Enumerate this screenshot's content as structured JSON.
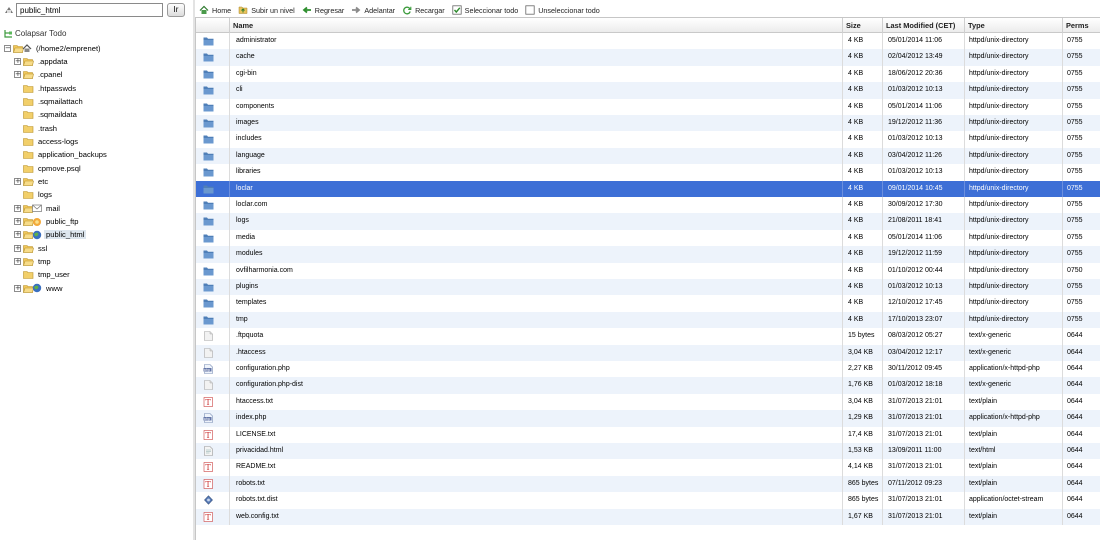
{
  "path_bar": {
    "value": "public_html",
    "go_label": "Ir"
  },
  "collapse_label": "Colapsar Todo",
  "tree": [
    {
      "label": "(/home2/emprenet)",
      "depth": 0,
      "toggle": "−",
      "kind": "root"
    },
    {
      "label": ".appdata",
      "depth": 1,
      "toggle": "+",
      "kind": "folder"
    },
    {
      "label": ".cpanel",
      "depth": 1,
      "toggle": "+",
      "kind": "folder"
    },
    {
      "label": ".htpasswds",
      "depth": 1,
      "toggle": "",
      "kind": "folder"
    },
    {
      "label": ".sqmailattach",
      "depth": 1,
      "toggle": "",
      "kind": "folder"
    },
    {
      "label": ".sqmaildata",
      "depth": 1,
      "toggle": "",
      "kind": "folder"
    },
    {
      "label": ".trash",
      "depth": 1,
      "toggle": "",
      "kind": "folder"
    },
    {
      "label": "access-logs",
      "depth": 1,
      "toggle": "",
      "kind": "folder"
    },
    {
      "label": "application_backups",
      "depth": 1,
      "toggle": "",
      "kind": "folder"
    },
    {
      "label": "cpmove.psql",
      "depth": 1,
      "toggle": "",
      "kind": "folder"
    },
    {
      "label": "etc",
      "depth": 1,
      "toggle": "+",
      "kind": "folder"
    },
    {
      "label": "logs",
      "depth": 1,
      "toggle": "",
      "kind": "folder"
    },
    {
      "label": "mail",
      "depth": 1,
      "toggle": "+",
      "kind": "mail"
    },
    {
      "label": "public_ftp",
      "depth": 1,
      "toggle": "+",
      "kind": "ftp"
    },
    {
      "label": "public_html",
      "depth": 1,
      "toggle": "+",
      "kind": "web",
      "selected": true
    },
    {
      "label": "ssl",
      "depth": 1,
      "toggle": "+",
      "kind": "folder"
    },
    {
      "label": "tmp",
      "depth": 1,
      "toggle": "+",
      "kind": "folder"
    },
    {
      "label": "tmp_user",
      "depth": 1,
      "toggle": "",
      "kind": "folder"
    },
    {
      "label": "www",
      "depth": 1,
      "toggle": "+",
      "kind": "web"
    }
  ],
  "toolbar": [
    {
      "label": "Home",
      "icon": "home-icon"
    },
    {
      "label": "Subir un nivel",
      "icon": "up-level-icon"
    },
    {
      "label": "Regresar",
      "icon": "back-arrow-icon"
    },
    {
      "label": "Adelantar",
      "icon": "forward-arrow-icon"
    },
    {
      "label": "Recargar",
      "icon": "reload-icon"
    },
    {
      "label": "Seleccionar todo",
      "icon": "select-all-icon"
    },
    {
      "label": "Unseleccionar todo",
      "icon": "unselect-all-icon"
    }
  ],
  "columns": {
    "name": "Name",
    "size": "Size",
    "modified": "Last Modified (CET)",
    "type": "Type",
    "perms": "Perms"
  },
  "files": [
    {
      "name": "administrator",
      "size": "4 KB",
      "modified": "05/01/2014 11:06",
      "type": "httpd/unix-directory",
      "perms": "0755",
      "icon": "folder"
    },
    {
      "name": "cache",
      "size": "4 KB",
      "modified": "02/04/2012 13:49",
      "type": "httpd/unix-directory",
      "perms": "0755",
      "icon": "folder"
    },
    {
      "name": "cgi-bin",
      "size": "4 KB",
      "modified": "18/06/2012 20:36",
      "type": "httpd/unix-directory",
      "perms": "0755",
      "icon": "folder"
    },
    {
      "name": "cli",
      "size": "4 KB",
      "modified": "01/03/2012 10:13",
      "type": "httpd/unix-directory",
      "perms": "0755",
      "icon": "folder"
    },
    {
      "name": "components",
      "size": "4 KB",
      "modified": "05/01/2014 11:06",
      "type": "httpd/unix-directory",
      "perms": "0755",
      "icon": "folder"
    },
    {
      "name": "images",
      "size": "4 KB",
      "modified": "19/12/2012 11:36",
      "type": "httpd/unix-directory",
      "perms": "0755",
      "icon": "folder"
    },
    {
      "name": "includes",
      "size": "4 KB",
      "modified": "01/03/2012 10:13",
      "type": "httpd/unix-directory",
      "perms": "0755",
      "icon": "folder"
    },
    {
      "name": "language",
      "size": "4 KB",
      "modified": "03/04/2012 11:26",
      "type": "httpd/unix-directory",
      "perms": "0755",
      "icon": "folder"
    },
    {
      "name": "libraries",
      "size": "4 KB",
      "modified": "01/03/2012 10:13",
      "type": "httpd/unix-directory",
      "perms": "0755",
      "icon": "folder"
    },
    {
      "name": "loclar",
      "size": "4 KB",
      "modified": "09/01/2014 10:45",
      "type": "httpd/unix-directory",
      "perms": "0755",
      "icon": "folder",
      "selected": true
    },
    {
      "name": "loclar.com",
      "size": "4 KB",
      "modified": "30/09/2012 17:30",
      "type": "httpd/unix-directory",
      "perms": "0755",
      "icon": "folder"
    },
    {
      "name": "logs",
      "size": "4 KB",
      "modified": "21/08/2011 18:41",
      "type": "httpd/unix-directory",
      "perms": "0755",
      "icon": "folder"
    },
    {
      "name": "media",
      "size": "4 KB",
      "modified": "05/01/2014 11:06",
      "type": "httpd/unix-directory",
      "perms": "0755",
      "icon": "folder"
    },
    {
      "name": "modules",
      "size": "4 KB",
      "modified": "19/12/2012 11:59",
      "type": "httpd/unix-directory",
      "perms": "0755",
      "icon": "folder"
    },
    {
      "name": "ovfilharmonia.com",
      "size": "4 KB",
      "modified": "01/10/2012 00:44",
      "type": "httpd/unix-directory",
      "perms": "0750",
      "icon": "folder"
    },
    {
      "name": "plugins",
      "size": "4 KB",
      "modified": "01/03/2012 10:13",
      "type": "httpd/unix-directory",
      "perms": "0755",
      "icon": "folder"
    },
    {
      "name": "templates",
      "size": "4 KB",
      "modified": "12/10/2012 17:45",
      "type": "httpd/unix-directory",
      "perms": "0755",
      "icon": "folder"
    },
    {
      "name": "tmp",
      "size": "4 KB",
      "modified": "17/10/2013 23:07",
      "type": "httpd/unix-directory",
      "perms": "0755",
      "icon": "folder"
    },
    {
      "name": ".ftpquota",
      "size": "15 bytes",
      "modified": "08/03/2012 05:27",
      "type": "text/x-generic",
      "perms": "0644",
      "icon": "generic"
    },
    {
      "name": ".htaccess",
      "size": "3,04 KB",
      "modified": "03/04/2012 12:17",
      "type": "text/x-generic",
      "perms": "0644",
      "icon": "generic"
    },
    {
      "name": "configuration.php",
      "size": "2,27 KB",
      "modified": "30/11/2012 09:45",
      "type": "application/x-httpd-php",
      "perms": "0644",
      "icon": "php"
    },
    {
      "name": "configuration.php-dist",
      "size": "1,76 KB",
      "modified": "01/03/2012 18:18",
      "type": "text/x-generic",
      "perms": "0644",
      "icon": "generic"
    },
    {
      "name": "htaccess.txt",
      "size": "3,04 KB",
      "modified": "31/07/2013 21:01",
      "type": "text/plain",
      "perms": "0644",
      "icon": "text"
    },
    {
      "name": "index.php",
      "size": "1,29 KB",
      "modified": "31/07/2013 21:01",
      "type": "application/x-httpd-php",
      "perms": "0644",
      "icon": "php"
    },
    {
      "name": "LICENSE.txt",
      "size": "17,4 KB",
      "modified": "31/07/2013 21:01",
      "type": "text/plain",
      "perms": "0644",
      "icon": "text"
    },
    {
      "name": "privacidad.html",
      "size": "1,53 KB",
      "modified": "13/09/2011 11:00",
      "type": "text/html",
      "perms": "0644",
      "icon": "html"
    },
    {
      "name": "README.txt",
      "size": "4,14 KB",
      "modified": "31/07/2013 21:01",
      "type": "text/plain",
      "perms": "0644",
      "icon": "text"
    },
    {
      "name": "robots.txt",
      "size": "865 bytes",
      "modified": "07/11/2012 09:23",
      "type": "text/plain",
      "perms": "0644",
      "icon": "text"
    },
    {
      "name": "robots.txt.dist",
      "size": "865 bytes",
      "modified": "31/07/2013 21:01",
      "type": "application/octet-stream",
      "perms": "0644",
      "icon": "binary"
    },
    {
      "name": "web.config.txt",
      "size": "1,67 KB",
      "modified": "31/07/2013 21:01",
      "type": "text/plain",
      "perms": "0644",
      "icon": "text"
    }
  ],
  "colors": {
    "selected_row": "#3d6fd6",
    "alt_row": "#edf3fb",
    "folder_icon": "#4f7fb8"
  }
}
